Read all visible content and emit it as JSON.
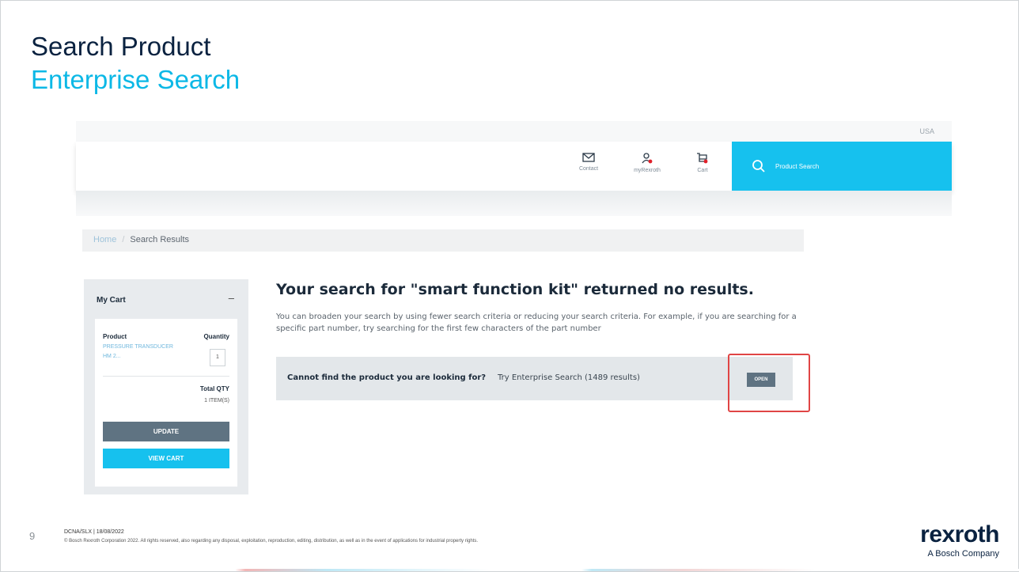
{
  "slide": {
    "title": "Search Product",
    "subtitle": "Enterprise Search",
    "page_number": "9",
    "footer_code": "DCNA/SLX | 18/08/2022",
    "footer_copyright": "© Bosch Rexroth Corporation 2022. All rights reserved, also regarding any disposal, exploitation, reproduction, editing, distribution, as well as in the event of applications for industrial property rights.",
    "logo": {
      "word": "rexroth",
      "tagline": "A Bosch Company"
    }
  },
  "site": {
    "country": "USA",
    "nav": {
      "contact_label": "Contact",
      "myrexroth_label": "myRexroth",
      "cart_label": "Cart"
    },
    "search": {
      "label": "Product Search"
    },
    "breadcrumb": {
      "home": "Home",
      "separator": "/",
      "current": "Search Results"
    },
    "cart": {
      "title": "My Cart",
      "collapse": "–",
      "col_product": "Product",
      "col_quantity": "Quantity",
      "product_name": "PRESSURE TRANSDUCER HM 2...",
      "quantity": "1",
      "total_label": "Total QTY",
      "total_value": "1 ITEM(S)",
      "update_label": "UPDATE",
      "view_cart_label": "VIEW CART"
    },
    "results": {
      "title": "Your search for \"smart function kit\" returned no results.",
      "help_text": "You can broaden your search by using fewer search criteria or reducing your search criteria. For example, if you are searching for a specific part number, try searching for the first few characters of the part number",
      "enterprise_question": "Cannot find the product you are looking for?",
      "enterprise_try": "Try Enterprise Search (1489 results)",
      "open_label": "OPEN"
    }
  },
  "colors": {
    "accent": "#16c1ee",
    "navy": "#0a2240",
    "highlight": "#e04545",
    "button_gray": "#5f7382"
  }
}
